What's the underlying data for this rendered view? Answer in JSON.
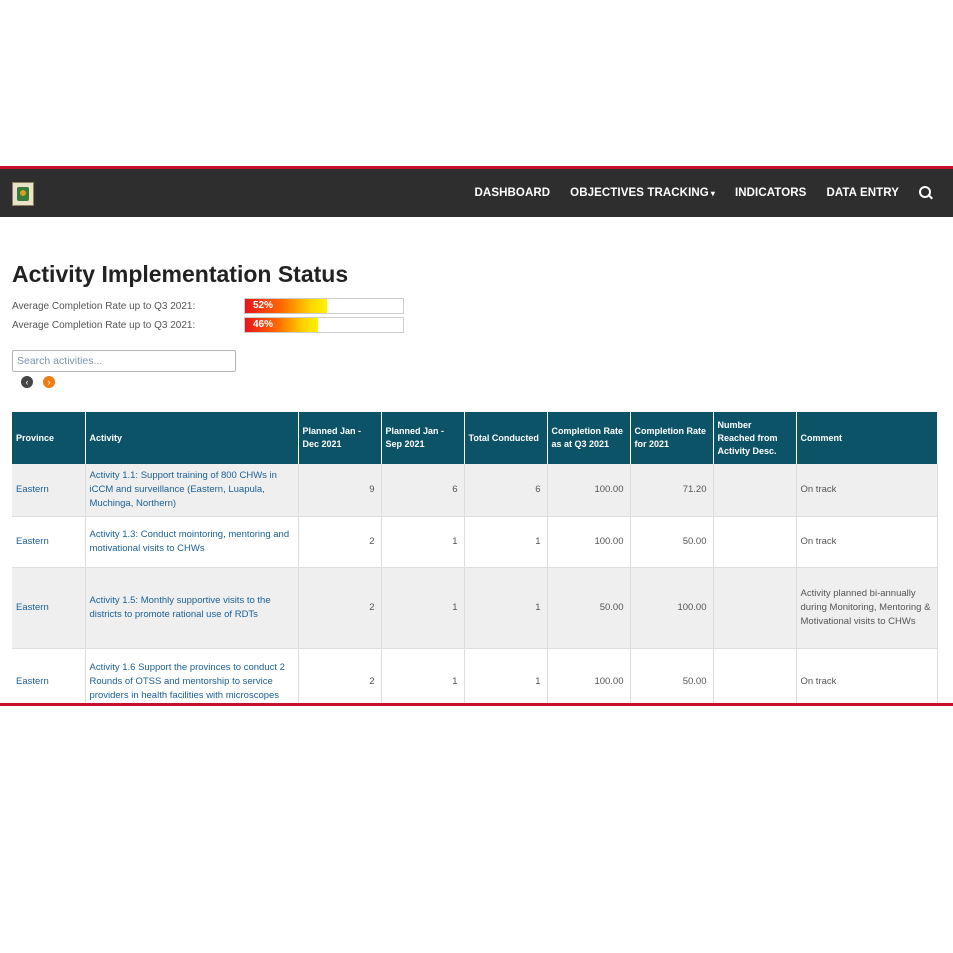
{
  "nav": {
    "items": [
      "DASHBOARD",
      "OBJECTIVES TRACKING",
      "INDICATORS",
      "DATA ENTRY"
    ],
    "objectives_caret": "▾"
  },
  "page": {
    "title": "Activity Implementation Status"
  },
  "rates": [
    {
      "label": "Average Completion Rate up to Q3 2021:",
      "value_text": "52%",
      "fraction": 0.52
    },
    {
      "label": "Average Completion Rate up to Q3 2021:",
      "value_text": "46%",
      "fraction": 0.46
    }
  ],
  "search": {
    "placeholder": "Search activities..."
  },
  "pager": {
    "prev": "‹",
    "next": "›",
    "prev_color": "#444444",
    "next_color": "#f07c12"
  },
  "colors": {
    "header_bg": "#0d5368",
    "accent_red": "#c8102e",
    "navbar_bg": "#2e2e2e"
  },
  "table": {
    "headers": [
      "Province",
      "Activity",
      "Planned Jan - Dec 2021",
      "Planned Jan - Sep 2021",
      "Total Conducted",
      "Completion Rate as at Q3 2021",
      "Completion Rate for 2021",
      "Number Reached from Activity Desc.",
      "Comment"
    ],
    "rows": [
      {
        "province": "Eastern",
        "activity": "Activity 1.1: Support training of 800 CHWs in iCCM and surveillance (Eastern, Luapula, Muchinga, Northern)",
        "planned_year": "9",
        "planned_sep": "6",
        "conducted": "6",
        "rate_q3": "100.00",
        "rate_year": "71.20",
        "reached": "",
        "comment": "On track"
      },
      {
        "province": "Eastern",
        "activity": "Activity 1.3: Conduct mointoring, mentoring and motivational visits to CHWs",
        "planned_year": "2",
        "planned_sep": "1",
        "conducted": "1",
        "rate_q3": "100.00",
        "rate_year": "50.00",
        "reached": "",
        "comment": "On track"
      },
      {
        "province": "Eastern",
        "activity": "Activity 1.5: Monthly supportive visits to the districts to promote rational use of RDTs",
        "planned_year": "2",
        "planned_sep": "1",
        "conducted": "1",
        "rate_q3": "50.00",
        "rate_year": "100.00",
        "reached": "",
        "comment": "Activity planned bi-annually during Monitoring, Mentoring & Motivational visits to CHWs"
      },
      {
        "province": "Eastern",
        "activity": "Activity 1.6 Support the provinces to conduct 2 Rounds of OTSS and mentorship to service providers in health facilities with microscopes",
        "planned_year": "2",
        "planned_sep": "1",
        "conducted": "1",
        "rate_q3": "100.00",
        "rate_year": "50.00",
        "reached": "",
        "comment": "On track"
      }
    ]
  }
}
